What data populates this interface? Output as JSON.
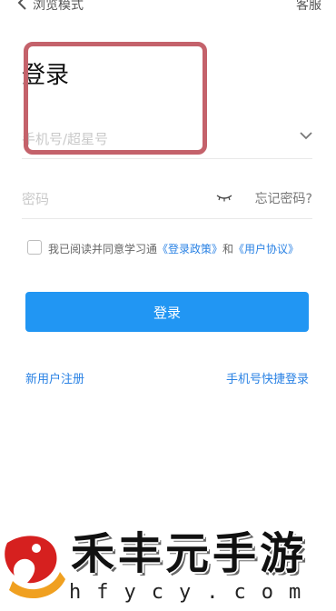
{
  "topbar": {
    "title": "浏览模式",
    "service": "客服"
  },
  "page_title": "登录",
  "account_field": {
    "placeholder": "手机号/超星号"
  },
  "password_field": {
    "placeholder": "密码",
    "forgot_label": "忘记密码?"
  },
  "agreement": {
    "prefix": "我已阅读并同意学习通",
    "policy": "《登录政策》",
    "and": "和",
    "user_agreement": "《用户协议》",
    "checked": false
  },
  "login_button": "登录",
  "links": {
    "register": "新用户注册",
    "quick_login": "手机号快捷登录"
  },
  "watermark": {
    "chars": [
      "禾",
      "丰",
      "元",
      "手",
      "游"
    ],
    "domain": "hfycy.com"
  },
  "colors": {
    "primary": "#2196f3",
    "link": "#2a82e4",
    "highlight": "#c4626b"
  }
}
